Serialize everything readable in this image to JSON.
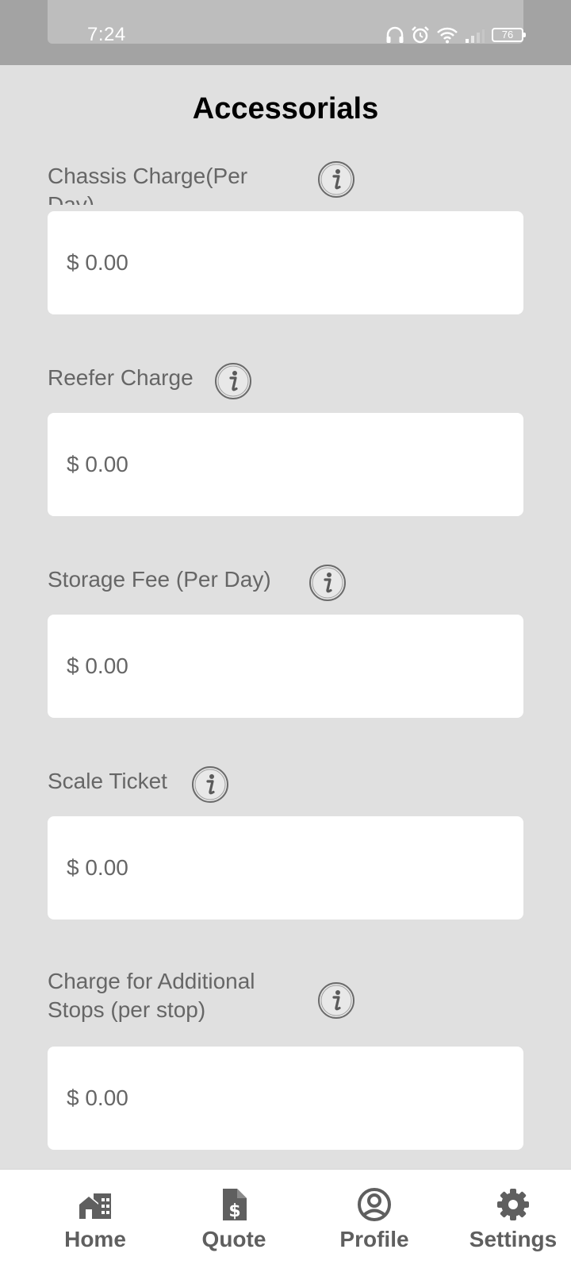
{
  "status_bar": {
    "time": "7:24",
    "battery": "76"
  },
  "header": {
    "title": "Accessorials"
  },
  "fields": [
    {
      "label": "Chassis Charge(Per Day)",
      "value": "$ 0.00"
    },
    {
      "label": "Reefer Charge",
      "value": "$ 0.00"
    },
    {
      "label": "Storage Fee (Per Day)",
      "value": "$ 0.00"
    },
    {
      "label": "Scale Ticket",
      "value": "$ 0.00"
    },
    {
      "label": "Charge for Additional Stops (per stop)",
      "value": "$ 0.00"
    }
  ],
  "nav": {
    "items": [
      {
        "label": "Home",
        "icon": "home-icon"
      },
      {
        "label": "Quote",
        "icon": "quote-icon"
      },
      {
        "label": "Profile",
        "icon": "profile-icon"
      },
      {
        "label": "Settings",
        "icon": "settings-icon"
      }
    ]
  },
  "colors": {
    "background": "#e0e0e0",
    "status_bar": "#a3a3a3",
    "label_text": "#666666",
    "nav_text": "#5f5f5f"
  }
}
